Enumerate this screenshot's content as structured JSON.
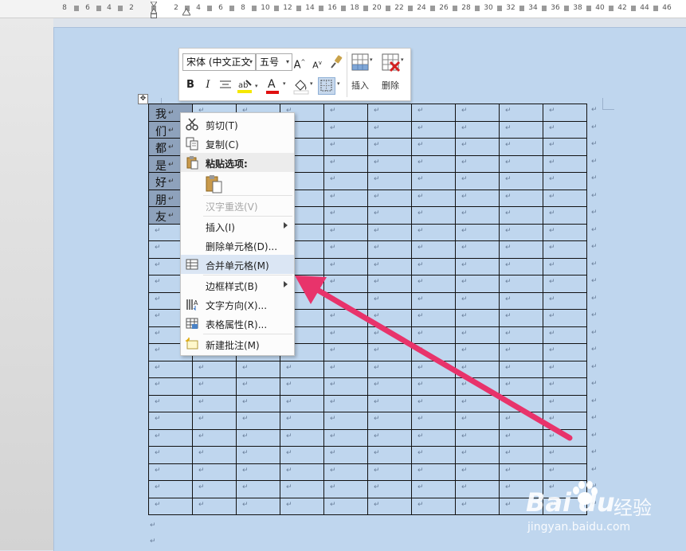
{
  "ruler": {
    "labels": [
      "8",
      "6",
      "4",
      "2",
      "2",
      "4",
      "6",
      "8",
      "10",
      "12",
      "14",
      "16",
      "18",
      "20",
      "22",
      "24",
      "26",
      "28",
      "30",
      "32",
      "34",
      "36",
      "38",
      "40",
      "42",
      "44",
      "46"
    ]
  },
  "mini_toolbar": {
    "font_name": "宋体 (中文正文",
    "font_size": "五号",
    "grow_font": "A",
    "shrink_font": "A",
    "bold": "B",
    "italic": "I",
    "font_color_letter": "A",
    "insert_label": "插入",
    "delete_label": "删除"
  },
  "table": {
    "selected_chars": [
      "我",
      "们",
      "都",
      "是",
      "好",
      "朋",
      "友"
    ],
    "cell_mark": "↵",
    "rows": 24,
    "cols": 10
  },
  "context_menu": {
    "items": [
      {
        "label": "剪切(T)",
        "icon": "scissors-icon"
      },
      {
        "label": "复制(C)",
        "icon": "copy-icon"
      },
      {
        "label": "粘贴选项:",
        "icon": "paste-icon"
      },
      {
        "label": "",
        "icon": "paste-keep-source-icon"
      },
      {
        "label": "汉字重选(V)",
        "icon": ""
      },
      {
        "label": "插入(I)",
        "icon": ""
      },
      {
        "label": "删除单元格(D)...",
        "icon": ""
      },
      {
        "label": "合并单元格(M)",
        "icon": "merge-cells-icon"
      },
      {
        "label": "边框样式(B)",
        "icon": ""
      },
      {
        "label": "文字方向(X)...",
        "icon": "text-direction-icon"
      },
      {
        "label": "表格属性(R)...",
        "icon": "table-properties-icon"
      },
      {
        "label": "新建批注(M)",
        "icon": "new-comment-icon"
      }
    ]
  },
  "watermark": {
    "brand_left": "Bai",
    "brand_right": "du",
    "brand_cn": "经验",
    "url": "jingyan.baidu.com"
  },
  "colors": {
    "page_bg": "#bfd6ee",
    "selection": "#8ea2bc",
    "arrow": "#e8336b",
    "menu_highlight": "#dbe6f4"
  }
}
